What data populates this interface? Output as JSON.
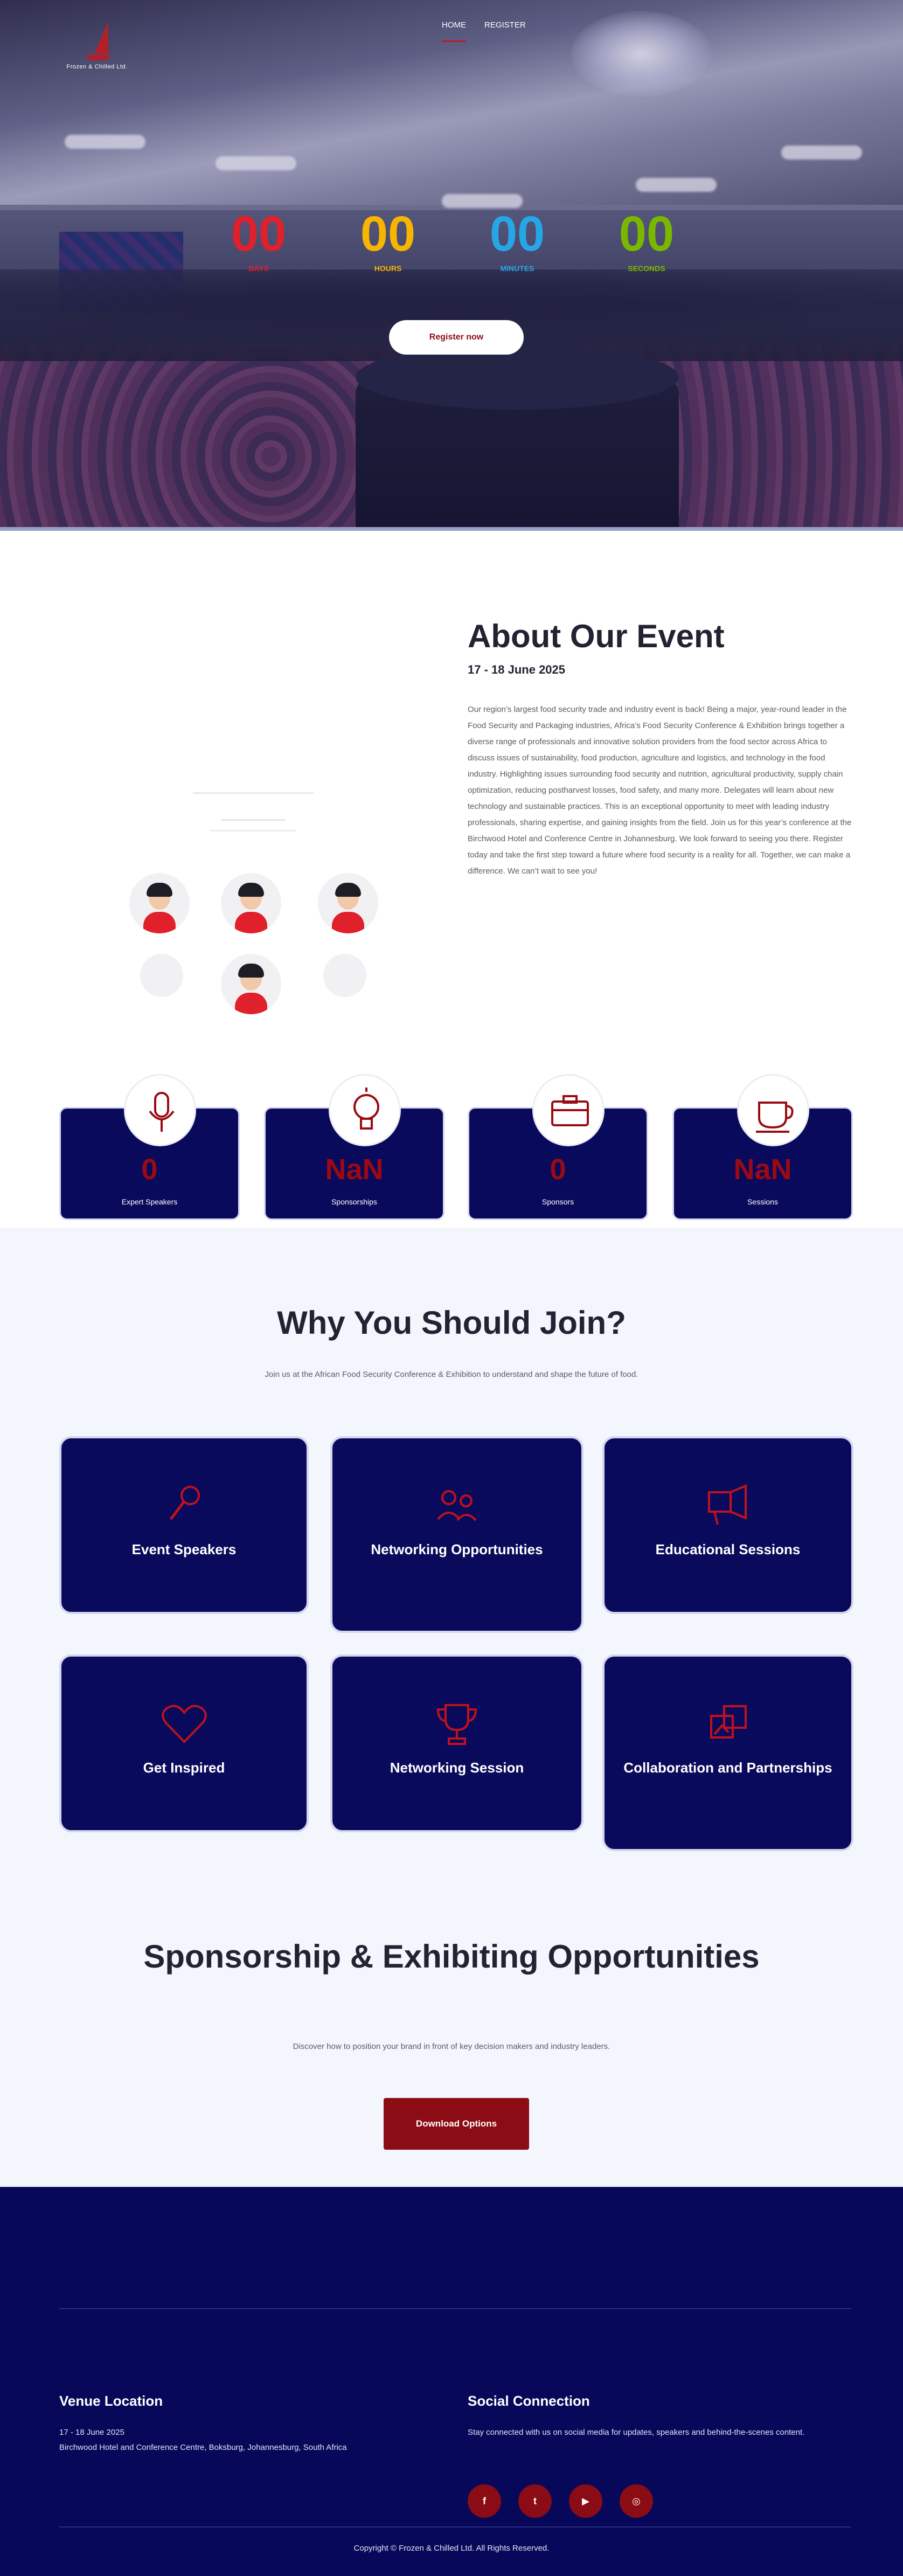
{
  "nav": {
    "logo_text": "Frozen & Chilled Ltd.",
    "items": [
      {
        "label": "HOME"
      },
      {
        "label": "REGISTER"
      }
    ]
  },
  "hero": {
    "countdown": [
      {
        "value": "00",
        "label": "DAYS",
        "color": "#e0202a"
      },
      {
        "value": "00",
        "label": "HOURS",
        "color": "#f7b500"
      },
      {
        "value": "00",
        "label": "MINUTES",
        "color": "#27a6e6"
      },
      {
        "value": "00",
        "label": "SECONDS",
        "color": "#7ab800"
      }
    ],
    "register_label": "Register now"
  },
  "about": {
    "title": "About Our Event",
    "date": "17 - 18 June 2025",
    "text": "Our region’s largest food security trade and industry event is back! Being a major, year-round leader in the Food Security and Packaging industries, Africa’s Food Security Conference & Exhibition brings together a diverse range of professionals and innovative solution providers from the food sector across Africa to discuss issues of sustainability, food production, agriculture and logistics, and technology in the food industry. Highlighting issues surrounding food security and nutrition, agricultural productivity, supply chain optimization, reducing postharvest losses, food safety, and many more. Delegates will learn about new technology and sustainable practices. This is an exceptional opportunity to meet with leading industry professionals, sharing expertise, and gaining insights from the field. Join us for this year’s conference at the Birchwood Hotel and Conference Centre in Johannesburg. We look forward to seeing you there. Register today and take the first step toward a future where food security is a reality for all. Together, we can make a difference. We can’t wait to see you!"
  },
  "stats": [
    {
      "value": "0",
      "label": "Expert Speakers",
      "icon": "microphone-icon"
    },
    {
      "value": "NaN",
      "label": "Sponsorships",
      "icon": "lightbulb-icon"
    },
    {
      "value": "0",
      "label": "Sponsors",
      "icon": "briefcase-icon"
    },
    {
      "value": "NaN",
      "label": "Sessions",
      "icon": "coffee-cup-icon"
    }
  ],
  "why": {
    "title": "Why You Should Join?",
    "subtitle": "Join us at the African Food Security Conference & Exhibition to understand and shape the future of food.",
    "cards": [
      {
        "label": "Event Speakers",
        "icon": "microphone-icon"
      },
      {
        "label": "Networking Opportunities",
        "icon": "handshake-icon"
      },
      {
        "label": "Educational Sessions",
        "icon": "megaphone-icon"
      },
      {
        "label": "Get Inspired",
        "icon": "heart-icon"
      },
      {
        "label": "Networking Session",
        "icon": "trophy-icon"
      },
      {
        "label": "Collaboration and Partnerships",
        "icon": "collaboration-icon"
      }
    ]
  },
  "sponsorship": {
    "title": "Sponsorship & Exhibiting Opportunities",
    "text": "Discover how to position your brand in front of key decision makers and industry leaders.",
    "button_label": "Download Options"
  },
  "footer": {
    "venue_heading": "Venue Location",
    "venue_date": "17 - 18 June 2025",
    "venue_address": "Birchwood Hotel and Conference Centre, Boksburg, Johannesburg, South Africa",
    "social_heading": "Social Connection",
    "social_text": "Stay connected with us on social media for updates, speakers and behind-the-scenes content.",
    "social_icons": [
      {
        "name": "facebook-icon",
        "glyph": "f"
      },
      {
        "name": "twitter-icon",
        "glyph": "t"
      },
      {
        "name": "youtube-icon",
        "glyph": "▶"
      },
      {
        "name": "instagram-icon",
        "glyph": "◎"
      }
    ],
    "copyright": "Copyright © Frozen & Chilled Ltd. All Rights Reserved."
  },
  "colors": {
    "brand_red": "#8b0c14",
    "navy": "#0a0a5c",
    "footer_navy": "#07085a"
  }
}
